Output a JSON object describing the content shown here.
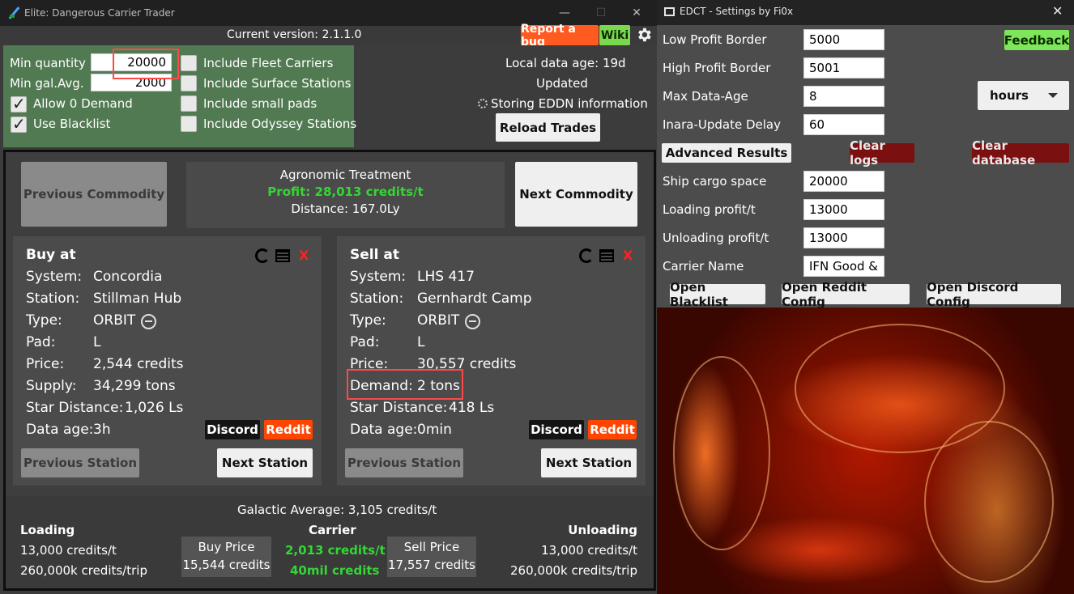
{
  "main": {
    "title": "Elite: Dangerous Carrier Trader",
    "version": "Current version: 2.1.1.0",
    "report_bug": "Report a bug",
    "wiki": "Wiki",
    "filters": {
      "min_quantity_label": "Min quantity",
      "min_quantity_value": "20000",
      "min_gal_avg_label": "Min gal.Avg.",
      "min_gal_avg_value": "2000",
      "allow_zero_demand": "Allow 0 Demand",
      "use_blacklist": "Use Blacklist",
      "include_fleet_carriers": "Include Fleet Carriers",
      "include_surface_stations": "Include Surface Stations",
      "include_small_pads": "Include small pads",
      "include_odyssey_stations": "Include Odyssey Stations",
      "checked": {
        "allow_zero_demand": true,
        "use_blacklist": true,
        "include_fleet_carriers": false,
        "include_surface_stations": false,
        "include_small_pads": false,
        "include_odyssey_stations": false
      }
    },
    "status": {
      "local_data_age": "Local data age: 19d",
      "updated": "Updated",
      "storing": "Storing EDDN information",
      "reload": "Reload Trades"
    },
    "commodity": {
      "prev": "Previous Commodity",
      "next": "Next Commodity",
      "name": "Agronomic Treatment",
      "profit": "Profit: 28,013 credits/t",
      "distance": "Distance: 167.0Ly"
    },
    "buy": {
      "heading": "Buy at",
      "system_label": "System:",
      "system": "Concordia",
      "station_label": "Station:",
      "station": "Stillman Hub",
      "type_label": "Type:",
      "type": "ORBIT",
      "pad_label": "Pad:",
      "pad": "L",
      "price_label": "Price:",
      "price": "2,544 credits",
      "supply_label": "Supply:",
      "supply": "34,299 tons",
      "star_label": "Star Distance:",
      "star": "1,026 Ls",
      "age_label": "Data age:",
      "age": "3h",
      "discord": "Discord",
      "reddit": "Reddit",
      "prev_station": "Previous Station",
      "next_station": "Next Station",
      "close": "X"
    },
    "sell": {
      "heading": "Sell at",
      "system_label": "System:",
      "system": "LHS 417",
      "station_label": "Station:",
      "station": "Gernhardt Camp",
      "type_label": "Type:",
      "type": "ORBIT",
      "pad_label": "Pad:",
      "pad": "L",
      "price_label": "Price:",
      "price": "30,557 credits",
      "demand_label": "Demand:",
      "demand": "2 tons",
      "star_label": "Star Distance:",
      "star": "418 Ls",
      "age_label": "Data age:",
      "age": "0min",
      "discord": "Discord",
      "reddit": "Reddit",
      "prev_station": "Previous Station",
      "next_station": "Next Station",
      "close": "X"
    },
    "summary": {
      "galactic_avg": "Galactic Average: 3,105 credits/t",
      "loading": "Loading",
      "loading_rate": "13,000 credits/t",
      "loading_trip": "260,000k credits/trip",
      "buy_price_label": "Buy Price",
      "buy_price": "15,544 credits",
      "carrier": "Carrier",
      "carrier_rate": "2,013 credits/t",
      "carrier_total": "40mil credits",
      "sell_price_label": "Sell Price",
      "sell_price": "17,557 credits",
      "unloading": "Unloading",
      "unloading_rate": "13,000 credits/t",
      "unloading_trip": "260,000k credits/trip"
    }
  },
  "settings": {
    "title": "EDCT - Settings by Fi0x",
    "low_profit_label": "Low Profit Border",
    "low_profit": "5000",
    "high_profit_label": "High Profit Border",
    "high_profit": "5001",
    "max_age_label": "Max Data-Age",
    "max_age": "8",
    "inara_label": "Inara-Update Delay",
    "inara": "60",
    "feedback": "Feedback",
    "unit_select": "hours",
    "advanced": "Advanced Results",
    "clear_logs": "Clear logs",
    "clear_db": "Clear database",
    "cargo_label": "Ship cargo space",
    "cargo": "20000",
    "loading_label": "Loading profit/t",
    "loading": "13000",
    "unloading_label": "Unloading profit/t",
    "unloading": "13000",
    "carrier_label": "Carrier Name",
    "carrier": "IFN Good &",
    "open_blacklist": "Open Blacklist",
    "open_reddit": "Open Reddit Config",
    "open_discord": "Open Discord Config"
  },
  "colors": {
    "accent_green": "#35d635",
    "reddit": "#ff4500",
    "report": "#ff5a1f",
    "wiki": "#7ad84f",
    "danger": "#7a1010",
    "filter_bg": "#527a52"
  }
}
